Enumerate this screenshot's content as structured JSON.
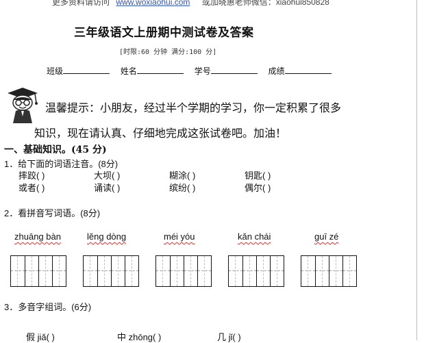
{
  "header_note": {
    "text_left": "更多资料请访问",
    "link": "www.woxiaohui.com",
    "text_right": "或加晓惠老师微信：xiaohui850828"
  },
  "title": "三年级语文上册期中测试卷及答案",
  "subtitle": "[时限:60 分钟    满分:100 分]",
  "info_fields": [
    "班级",
    "姓名",
    "学号",
    "成绩"
  ],
  "tip": {
    "line1": "温馨提示：小朋友，经过半个学期的学习，你一定积累了很多",
    "line2": "知识，现在请认真、仔细地完成这张试卷吧。加油！"
  },
  "section1": {
    "heading": "一、基础知识。(45 分)",
    "q1": {
      "label": "1．给下面的词语注音。(8分)",
      "row1": [
        "摔跤(          )",
        "大坝(          )",
        "糊涂(          )",
        "钥匙(          )"
      ],
      "row2": [
        "或者(          )",
        "诵读(          )",
        "缤纷(          )",
        "偶尔(          )"
      ]
    },
    "q2": {
      "label": "2．看拼音写词语。(8分)",
      "pinyin": [
        "zhuāng bàn",
        "lěng   dòng",
        "méi   yóu",
        "kǎn   chái",
        "guī   zé"
      ]
    },
    "q3": {
      "label": "3．多音字组词。(6分)",
      "row": [
        "假 jiǎ(          )",
        "中 zhōng(          )",
        "几 jǐ(          )"
      ]
    }
  }
}
